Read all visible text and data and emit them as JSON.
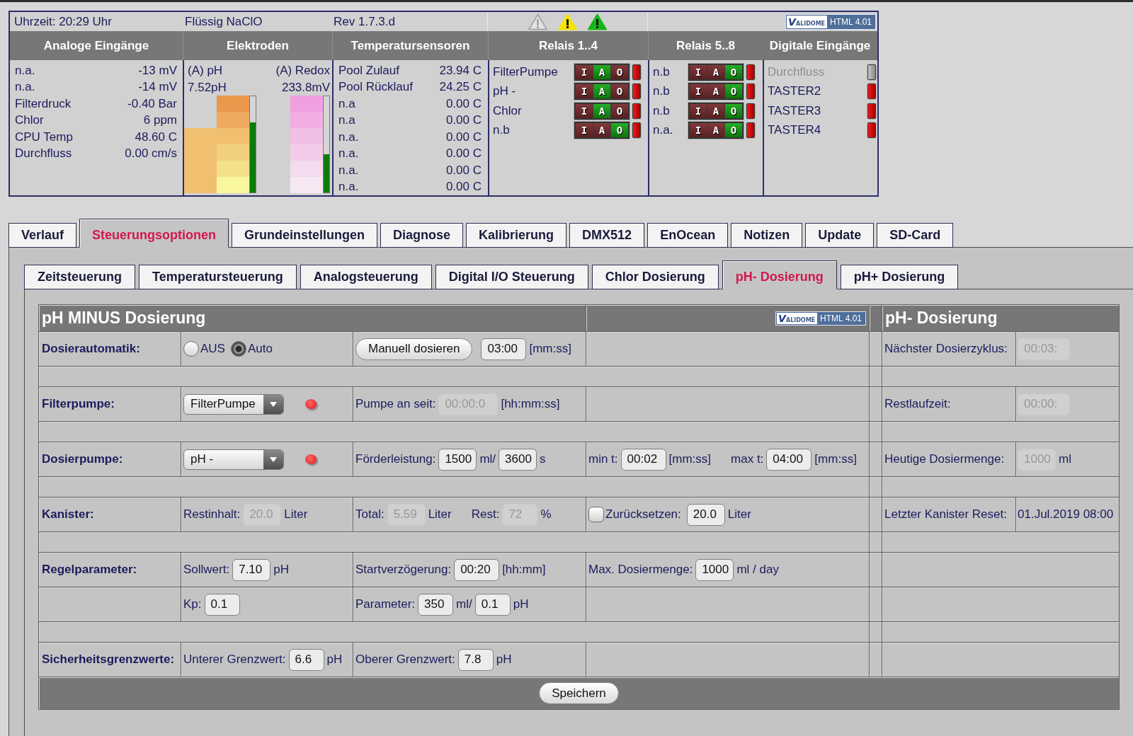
{
  "info_bar": {
    "time": "Uhrzeit: 20:29 Uhr",
    "medium": "Flüssig NaClO",
    "revision": "Rev 1.7.3.d",
    "warnings": [
      {
        "active": false,
        "color": "#a8a8a8"
      },
      {
        "active": true,
        "color": "#f5e400"
      },
      {
        "active": true,
        "color": "#14b814"
      }
    ],
    "badge": {
      "logo": "VALIDOME",
      "label": "HTML 4.01"
    }
  },
  "analog_inputs": {
    "title": "Analoge Eingänge",
    "rows": [
      {
        "name": "n.a.",
        "value": "-13 mV"
      },
      {
        "name": "n.a.",
        "value": "-14 mV"
      },
      {
        "name": "Filterdruck",
        "value": "-0.40 Bar"
      },
      {
        "name": "Chlor",
        "value": "6 ppm"
      },
      {
        "name": "CPU Temp",
        "value": "48.60 C"
      },
      {
        "name": "Durchfluss",
        "value": "0.00 cm/s"
      }
    ]
  },
  "electrodes": {
    "title": "Elektroden",
    "items": [
      {
        "kind": "ph",
        "name": "(A) pH",
        "value": "7.52pH",
        "level": 0.73
      },
      {
        "kind": "redox",
        "name": "(A) Redox",
        "value": "233.8mV",
        "level": 0.4
      }
    ]
  },
  "temperature_sensors": {
    "title": "Temperatursensoren",
    "rows": [
      {
        "name": "Pool Zulauf",
        "value": "23.94 C"
      },
      {
        "name": "Pool Rücklauf",
        "value": "24.25 C"
      },
      {
        "name": "n.a",
        "value": "0.00 C"
      },
      {
        "name": "n.a",
        "value": "0.00 C"
      },
      {
        "name": "n.a.",
        "value": "0.00 C"
      },
      {
        "name": "n.a.",
        "value": "0.00 C"
      },
      {
        "name": "n.a.",
        "value": "0.00 C"
      },
      {
        "name": "n.a.",
        "value": "0.00 C"
      }
    ]
  },
  "relays_1_4": {
    "title": "Relais 1..4",
    "items": [
      {
        "name": "FilterPumpe",
        "on": false,
        "modes": [
          {
            "label": "I",
            "selected": false
          },
          {
            "label": "A",
            "selected": true
          },
          {
            "label": "O",
            "selected": false
          }
        ]
      },
      {
        "name": "pH -",
        "on": false,
        "modes": [
          {
            "label": "I",
            "selected": false
          },
          {
            "label": "A",
            "selected": true
          },
          {
            "label": "O",
            "selected": false
          }
        ]
      },
      {
        "name": "Chlor",
        "on": false,
        "modes": [
          {
            "label": "I",
            "selected": false
          },
          {
            "label": "A",
            "selected": true
          },
          {
            "label": "O",
            "selected": false
          }
        ]
      },
      {
        "name": "n.b",
        "on": false,
        "modes": [
          {
            "label": "I",
            "selected": false
          },
          {
            "label": "A",
            "selected": false
          },
          {
            "label": "O",
            "selected": true
          }
        ]
      }
    ]
  },
  "relays_5_8": {
    "title": "Relais 5..8",
    "items": [
      {
        "name": "n.b",
        "on": false,
        "modes": [
          {
            "label": "I",
            "selected": false
          },
          {
            "label": "A",
            "selected": false
          },
          {
            "label": "O",
            "selected": true
          }
        ]
      },
      {
        "name": "n.b",
        "on": false,
        "modes": [
          {
            "label": "I",
            "selected": false
          },
          {
            "label": "A",
            "selected": false
          },
          {
            "label": "O",
            "selected": true
          }
        ]
      },
      {
        "name": "n.b",
        "on": false,
        "modes": [
          {
            "label": "I",
            "selected": false
          },
          {
            "label": "A",
            "selected": false
          },
          {
            "label": "O",
            "selected": true
          }
        ]
      },
      {
        "name": "n.a.",
        "on": false,
        "modes": [
          {
            "label": "I",
            "selected": false
          },
          {
            "label": "A",
            "selected": false
          },
          {
            "label": "O",
            "selected": true
          }
        ]
      }
    ]
  },
  "digital_inputs": {
    "title": "Digitale Eingänge",
    "items": [
      {
        "name": "Durchfluss",
        "disabled": true,
        "on": false
      },
      {
        "name": "TASTER2",
        "disabled": false,
        "on": false
      },
      {
        "name": "TASTER3",
        "disabled": false,
        "on": false
      },
      {
        "name": "TASTER4",
        "disabled": false,
        "on": false
      }
    ]
  },
  "tabs": [
    {
      "label": "Verlauf",
      "selected": false
    },
    {
      "label": "Steuerungsoptionen",
      "selected": true
    },
    {
      "label": "Grundeinstellungen",
      "selected": false
    },
    {
      "label": "Diagnose",
      "selected": false
    },
    {
      "label": "Kalibrierung",
      "selected": false
    },
    {
      "label": "DMX512",
      "selected": false
    },
    {
      "label": "EnOcean",
      "selected": false
    },
    {
      "label": "Notizen",
      "selected": false
    },
    {
      "label": "Update",
      "selected": false
    },
    {
      "label": "SD-Card",
      "selected": false
    }
  ],
  "subtabs": [
    {
      "label": "Zeitsteuerung",
      "selected": false
    },
    {
      "label": "Temperatursteuerung",
      "selected": false
    },
    {
      "label": "Analogsteuerung",
      "selected": false
    },
    {
      "label": "Digital I/O Steuerung",
      "selected": false
    },
    {
      "label": "Chlor Dosierung",
      "selected": false
    },
    {
      "label": "pH- Dosierung",
      "selected": true
    },
    {
      "label": "pH+ Dosierung",
      "selected": false
    }
  ],
  "form": {
    "title": "pH MINUS Dosierung",
    "badge": {
      "logo": "VALIDOME",
      "label": "HTML 4.01"
    },
    "side_title": "pH- Dosierung",
    "rows": [
      {
        "kind": "fields",
        "label": "Dosierautomatik:",
        "column_2": [
          [
            {
              "kind": "radio",
              "label": "AUS",
              "selected": false
            },
            {
              "kind": "radio",
              "label": "Auto",
              "selected": true
            }
          ]
        ],
        "column_3": [
          [
            {
              "kind": "button",
              "label": "Manuell dosieren"
            },
            {
              "kind": "input",
              "value": "03:00",
              "disabled": false
            },
            {
              "kind": "text",
              "text": "[mm:ss]"
            }
          ]
        ],
        "side": {
          "label": "Nächster Dosierzyklus:",
          "items": [
            {
              "kind": "input",
              "value": "00:03:",
              "disabled": true
            }
          ]
        }
      },
      {
        "kind": "spacer"
      },
      {
        "kind": "fields",
        "label": "Filterpumpe:",
        "column_2": [
          [
            {
              "kind": "select",
              "value": "FilterPumpe"
            }
          ],
          [
            {
              "kind": "led",
              "on": false
            }
          ]
        ],
        "column_3": [
          [
            {
              "kind": "text",
              "text": "Pumpe an seit:"
            },
            {
              "kind": "input",
              "value": "00:00:0",
              "disabled": true
            },
            {
              "kind": "text",
              "text": "[hh:mm:ss]"
            }
          ]
        ],
        "side": {
          "label": "Restlaufzeit:",
          "items": [
            {
              "kind": "input",
              "value": "00:00:",
              "disabled": true
            }
          ]
        }
      },
      {
        "kind": "spacer"
      },
      {
        "kind": "fields",
        "label": "Dosierpumpe:",
        "column_2": [
          [
            {
              "kind": "select",
              "value": "pH -"
            }
          ],
          [
            {
              "kind": "led",
              "on": false
            }
          ]
        ],
        "column_3": [
          [
            {
              "kind": "text",
              "text": "Förderleistung:"
            },
            {
              "kind": "input",
              "value": "1500",
              "disabled": false
            },
            {
              "kind": "text",
              "text": "ml/"
            },
            {
              "kind": "input",
              "value": "3600",
              "disabled": false
            },
            {
              "kind": "text",
              "text": "s"
            }
          ]
        ],
        "column_4": [
          [
            {
              "kind": "text",
              "text": "min t:"
            },
            {
              "kind": "input",
              "value": "00:02",
              "disabled": false
            },
            {
              "kind": "text",
              "text": "[mm:ss]"
            }
          ],
          [
            {
              "kind": "text",
              "text": "max t:"
            },
            {
              "kind": "input",
              "value": "04:00",
              "disabled": false
            },
            {
              "kind": "text",
              "text": "[mm:ss]"
            }
          ]
        ],
        "side": {
          "label": "Heutige Dosiermenge:",
          "items": [
            {
              "kind": "input",
              "value": "1000",
              "disabled": true
            },
            {
              "kind": "text",
              "text": "ml"
            }
          ]
        }
      },
      {
        "kind": "spacer"
      },
      {
        "kind": "fields",
        "label": "Kanister:",
        "column_2": [
          [
            {
              "kind": "text",
              "text": "Restinhalt:"
            },
            {
              "kind": "input",
              "value": "20.0",
              "disabled": true
            },
            {
              "kind": "text",
              "text": "Liter"
            }
          ]
        ],
        "column_3": [
          [
            {
              "kind": "text",
              "text": "Total:"
            },
            {
              "kind": "input",
              "value": "5.59",
              "disabled": true
            },
            {
              "kind": "text",
              "text": "Liter"
            }
          ],
          [
            {
              "kind": "text",
              "text": "Rest:"
            },
            {
              "kind": "input",
              "value": "72",
              "disabled": true
            },
            {
              "kind": "text",
              "text": "%"
            }
          ]
        ],
        "column_4": [
          [
            {
              "kind": "checkbox",
              "label": "Zurücksetzen:",
              "checked": false
            },
            {
              "kind": "input",
              "value": "20.0",
              "disabled": false
            },
            {
              "kind": "text",
              "text": "Liter"
            }
          ]
        ],
        "side": {
          "label": "Letzter Kanister Reset:",
          "items": [
            {
              "kind": "text",
              "text": "01.Jul.2019 08:00"
            }
          ]
        }
      },
      {
        "kind": "spacer"
      },
      {
        "kind": "fields",
        "label": "Regelparameter:",
        "column_2": [
          [
            {
              "kind": "text",
              "text": "Sollwert:"
            },
            {
              "kind": "input",
              "value": "7.10",
              "disabled": false
            },
            {
              "kind": "text",
              "text": "pH"
            }
          ]
        ],
        "column_3": [
          [
            {
              "kind": "text",
              "text": "Startverzögerung:"
            },
            {
              "kind": "input",
              "value": "00:20",
              "disabled": false
            },
            {
              "kind": "text",
              "text": "[hh:mm]"
            }
          ]
        ],
        "column_4": [
          [
            {
              "kind": "text",
              "text": "Max. Dosiermenge:"
            },
            {
              "kind": "input",
              "value": "1000",
              "disabled": false
            },
            {
              "kind": "text",
              "text": "ml / day"
            }
          ]
        ]
      },
      {
        "kind": "fields",
        "column_2": [
          [
            {
              "kind": "text",
              "text": "Kp:"
            },
            {
              "kind": "input",
              "value": "0.1",
              "disabled": false
            }
          ]
        ],
        "column_3": [
          [
            {
              "kind": "text",
              "text": "Parameter:"
            },
            {
              "kind": "input",
              "value": "350",
              "disabled": false
            },
            {
              "kind": "text",
              "text": "ml/"
            },
            {
              "kind": "input",
              "value": "0.1",
              "disabled": false
            },
            {
              "kind": "text",
              "text": "pH"
            }
          ]
        ]
      },
      {
        "kind": "spacer"
      },
      {
        "kind": "fields",
        "label": "Sicherheitsgrenzwerte:",
        "column_2": [
          [
            {
              "kind": "text",
              "text": "Unterer Grenzwert:"
            },
            {
              "kind": "input",
              "value": "6.6",
              "disabled": false
            },
            {
              "kind": "text",
              "text": "pH"
            }
          ]
        ],
        "column_3": [
          [
            {
              "kind": "text",
              "text": "Oberer Grenzwert:"
            },
            {
              "kind": "input",
              "value": "7.8",
              "disabled": false
            },
            {
              "kind": "text",
              "text": "pH"
            }
          ]
        ]
      }
    ],
    "save_button": "Speichern"
  }
}
